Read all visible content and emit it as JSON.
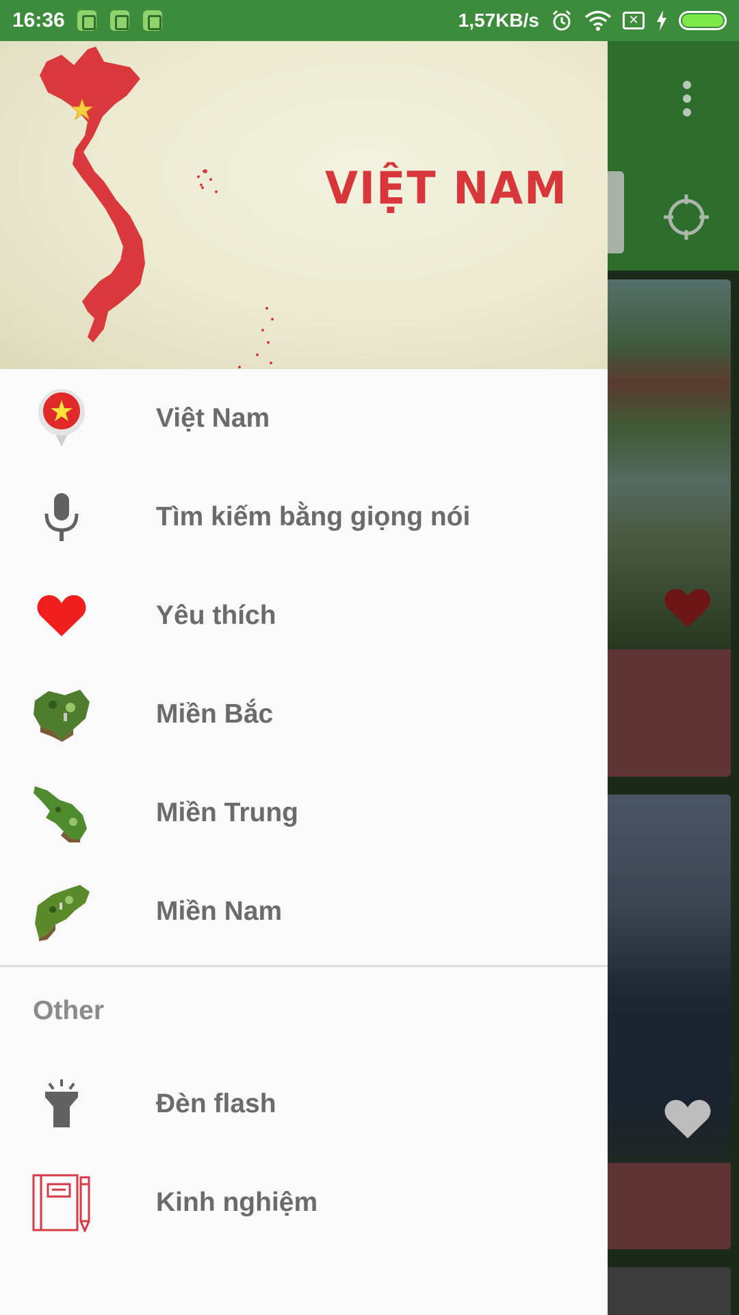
{
  "status_bar": {
    "time": "16:36",
    "network_speed": "1,57KB/s",
    "icons": [
      "battery-saver-icon",
      "android-icon",
      "android-icon",
      "alarm-icon",
      "wifi-icon",
      "no-sim-icon",
      "charging-icon",
      "battery-icon"
    ],
    "colors": {
      "background": "#3c8c3c",
      "battery_fill": "#7de84a"
    }
  },
  "drawer": {
    "header": {
      "title": "VIỆT NAM",
      "image": "vietnam-map-icon"
    },
    "items": [
      {
        "label": "Việt Nam",
        "icon": "vietnam-flag-pin-icon"
      },
      {
        "label": "Tìm kiếm bằng giọng nói",
        "icon": "microphone-icon"
      },
      {
        "label": "Yêu thích",
        "icon": "heart-icon"
      },
      {
        "label": "Miền Bắc",
        "icon": "north-region-map-icon"
      },
      {
        "label": "Miền Trung",
        "icon": "central-region-map-icon"
      },
      {
        "label": "Miền Nam",
        "icon": "south-region-map-icon"
      }
    ],
    "section_title": "Other",
    "other_items": [
      {
        "label": "Đèn flash",
        "icon": "flashlight-icon"
      },
      {
        "label": "Kinh nghiệm",
        "icon": "notebook-icon"
      }
    ],
    "colors": {
      "label": "#6b6b6b",
      "section": "#8a8a8a",
      "accent_red": "#d7373b"
    }
  },
  "background_app": {
    "toolbar_color": "#2d6e2d",
    "icons": [
      "overflow-menu-icon",
      "my-location-icon",
      "favorite-heart-icon",
      "favorite-heart-outline-icon"
    ]
  }
}
